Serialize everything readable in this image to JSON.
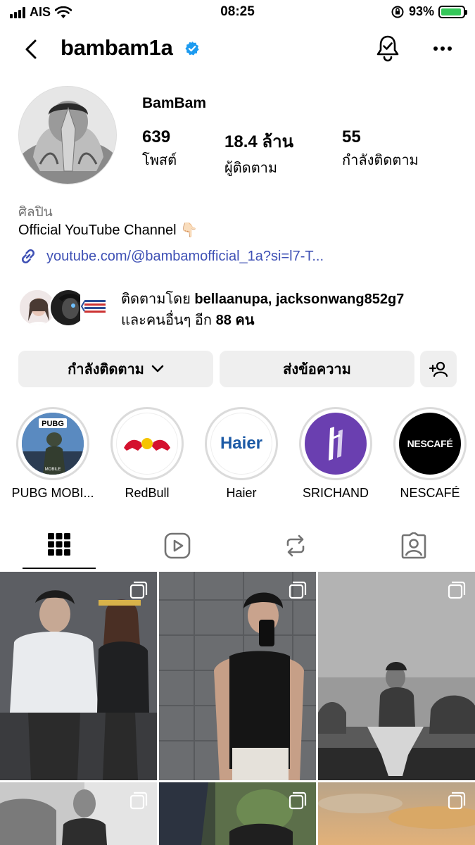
{
  "status": {
    "carrier": "AIS",
    "time": "08:25",
    "battery_percent": "93%",
    "battery_level": 0.93
  },
  "header": {
    "username": "bambam1a",
    "verified": true
  },
  "profile": {
    "display_name": "BamBam",
    "stats": [
      {
        "value": "639",
        "label": "โพสต์"
      },
      {
        "value": "18.4 ล้าน",
        "label": "ผู้ติดตาม"
      },
      {
        "value": "55",
        "label": "กำลังติดตาม"
      }
    ],
    "category": "ศิลปิน",
    "bio": "Official YouTube Channel 👇🏻",
    "link": "youtube.com/@bambamofficial_1a?si=l7-T..."
  },
  "followed_by": {
    "prefix": "ติดตามโดย ",
    "names": "bellaanupa, jacksonwang852g7",
    "suffix_prefix": "และคนอื่นๆ อีก ",
    "suffix_count": "88 คน"
  },
  "actions": {
    "following_label": "กำลังติดตาม",
    "message_label": "ส่งข้อความ"
  },
  "highlights": [
    {
      "label": "PUBG MOBI...",
      "logo": "PUBG"
    },
    {
      "label": "RedBull",
      "logo": "redbull"
    },
    {
      "label": "Haier",
      "logo": "Haier"
    },
    {
      "label": "SRICHAND",
      "logo": "srichand"
    },
    {
      "label": "NESCAFÉ",
      "logo": "NESCAFÉ"
    }
  ],
  "colors": {
    "link": "#3f51b5",
    "verified": "#1d9bf0",
    "button_bg": "#efefef",
    "ring": "#dbdbdb",
    "srichand_purple": "#6a3fb0"
  }
}
